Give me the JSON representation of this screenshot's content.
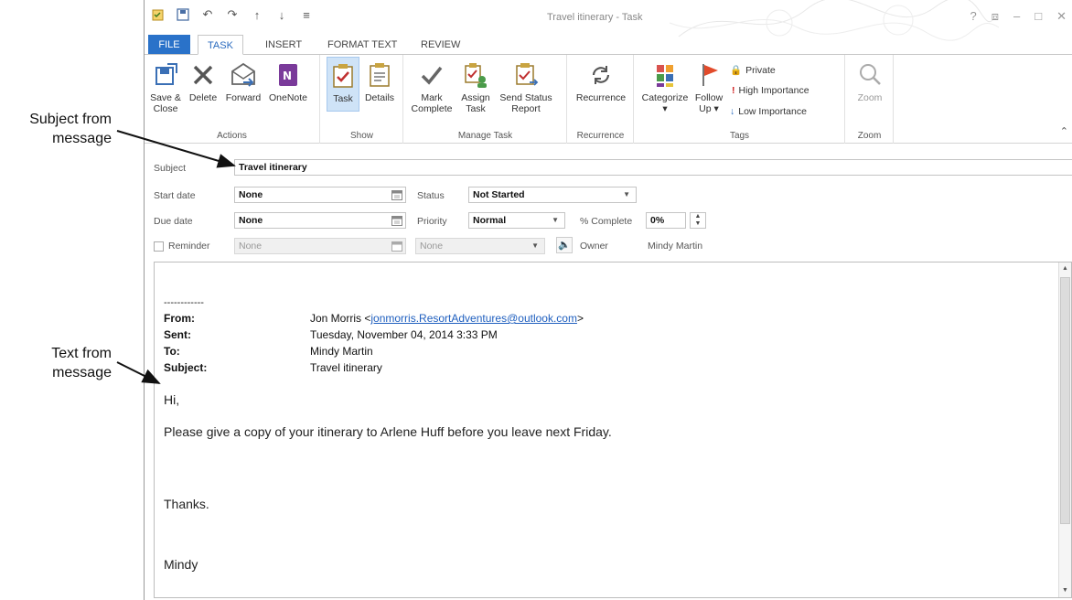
{
  "callouts": {
    "subject": [
      "Subject from",
      "message"
    ],
    "text": [
      "Text from",
      "message"
    ]
  },
  "window": {
    "title": "Travel itinerary - Task",
    "controls": [
      "?",
      "⧈",
      "–",
      "□",
      "✕"
    ]
  },
  "tabs": [
    "FILE",
    "TASK",
    "INSERT",
    "FORMAT TEXT",
    "REVIEW"
  ],
  "ribbon": {
    "actions": {
      "label": "Actions",
      "save_close": [
        "Save &",
        "Close"
      ],
      "delete": "Delete",
      "forward": "Forward",
      "onenote": "OneNote"
    },
    "show": {
      "label": "Show",
      "task": "Task",
      "details": "Details"
    },
    "manage": {
      "label": "Manage Task",
      "mark_complete": [
        "Mark",
        "Complete"
      ],
      "assign_task": [
        "Assign",
        "Task"
      ],
      "send_status": [
        "Send Status",
        "Report"
      ]
    },
    "recurrence": {
      "label": "Recurrence",
      "recurrence": "Recurrence"
    },
    "tags": {
      "label": "Tags",
      "categorize": "Categorize",
      "follow_up": [
        "Follow",
        "Up"
      ],
      "private": "Private",
      "high": "High Importance",
      "low": "Low Importance"
    },
    "zoom": {
      "label": "Zoom",
      "zoom": "Zoom"
    }
  },
  "form": {
    "subject_label": "Subject",
    "subject_value": "Travel itinerary",
    "start_label": "Start date",
    "start_value": "None",
    "due_label": "Due date",
    "due_value": "None",
    "reminder_label": "Reminder",
    "reminder_date": "None",
    "reminder_time": "None",
    "status_label": "Status",
    "status_value": "Not Started",
    "priority_label": "Priority",
    "priority_value": "Normal",
    "complete_label": "% Complete",
    "complete_value": "0%",
    "owner_label": "Owner",
    "owner_value": "Mindy Martin"
  },
  "message": {
    "separator": "------------",
    "from_label": "From:",
    "from_name": "Jon Morris <",
    "from_email": "jonmorris.ResortAdventures@outlook.com",
    "from_close": ">",
    "sent_label": "Sent:",
    "sent_value": "Tuesday, November 04, 2014 3:33 PM",
    "to_label": "To:",
    "to_value": "Mindy Martin",
    "subject_label": "Subject:",
    "subject_value": "Travel itinerary",
    "greeting": "Hi,",
    "body": "Please give a copy of your itinerary to Arlene Huff before you leave next Friday.",
    "thanks": "Thanks.",
    "signature": "Mindy"
  }
}
